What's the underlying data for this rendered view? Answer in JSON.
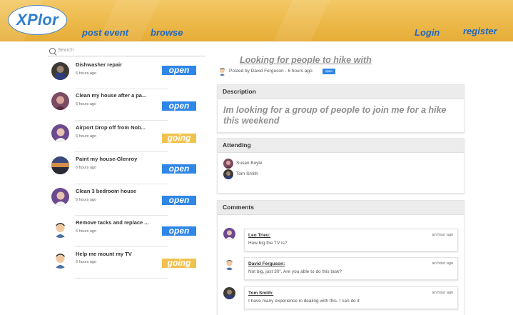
{
  "header": {
    "logo": "XPlor",
    "nav_left": [
      "post event",
      "browse"
    ],
    "nav_right": [
      "Login",
      "register"
    ]
  },
  "search": {
    "placeholder": "Search"
  },
  "tasks": [
    {
      "title": "Dishwasher repair",
      "time": "6 hours ago",
      "status": "open"
    },
    {
      "title": "Clean my house after a pa...",
      "time": "6 hours ago",
      "status": "open"
    },
    {
      "title": "Airport Drop off from Nob...",
      "time": "6 hours ago",
      "status": "going"
    },
    {
      "title": "Paint my house-Glenroy",
      "time": "6 hours ago",
      "status": "open"
    },
    {
      "title": "Clean 3 bedroom house",
      "time": "6 hours ago",
      "status": "open"
    },
    {
      "title": "Remove tacks and replace ...",
      "time": "6 hours ago",
      "status": "open"
    },
    {
      "title": "Help me mount my TV",
      "time": "6 hours ago",
      "status": "going"
    }
  ],
  "post": {
    "title": "Looking for people to hike with",
    "posted_by": "Posted by David Ferguson - 6 hours ago",
    "status": "open",
    "description_label": "Description",
    "description": "Im looking for a group of people to join me for a hike this weekend",
    "attending_label": "Attending",
    "attendees": [
      "Susan Boyle",
      "Tom Smith"
    ],
    "comments_label": "Comments",
    "comments": [
      {
        "name": "Leo Trieu:",
        "text": "How big the TV is?",
        "time": "an hour ago"
      },
      {
        "name": "David Ferguson:",
        "text": "Not big, just 30\". Are you able to do this task?",
        "time": "an hour ago"
      },
      {
        "name": "Tom Smith:",
        "text": "I have many experience in dealing with this. I can do it",
        "time": "an hour ago"
      }
    ]
  },
  "colors": {
    "header": "#ecb94a",
    "open": "#2f86e6",
    "going": "#f1c14f",
    "link": "#2168c4"
  }
}
